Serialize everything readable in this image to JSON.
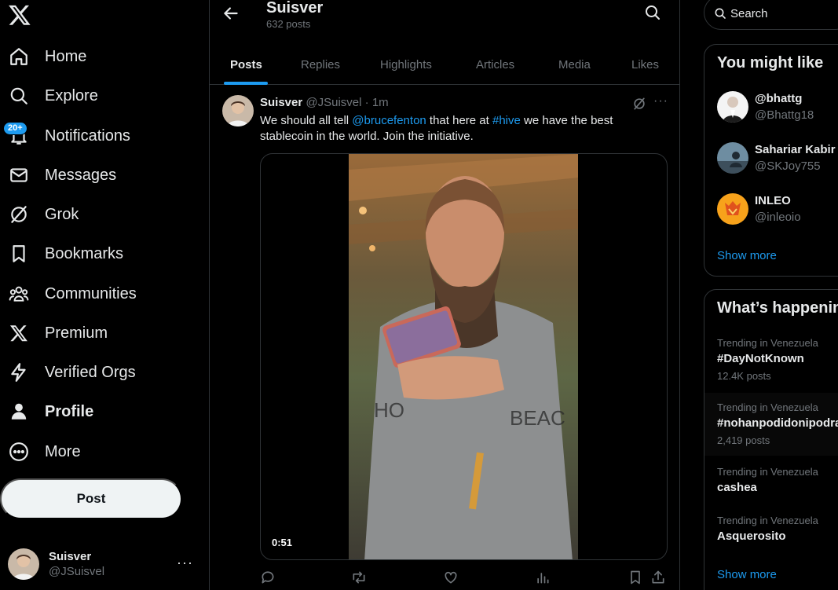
{
  "sidebar": {
    "logo": "x-logo-icon",
    "nav": [
      {
        "label": "Home",
        "icon": "home-icon"
      },
      {
        "label": "Explore",
        "icon": "search-icon"
      },
      {
        "label": "Notifications",
        "icon": "bell-icon",
        "badge": "20+"
      },
      {
        "label": "Messages",
        "icon": "envelope-icon"
      },
      {
        "label": "Grok",
        "icon": "grok-icon"
      },
      {
        "label": "Bookmarks",
        "icon": "bookmark-icon"
      },
      {
        "label": "Communities",
        "icon": "people-icon"
      },
      {
        "label": "Premium",
        "icon": "x-logo-icon"
      },
      {
        "label": "Verified Orgs",
        "icon": "lightning-icon"
      },
      {
        "label": "Profile",
        "icon": "person-icon"
      },
      {
        "label": "More",
        "icon": "more-circle-icon"
      }
    ],
    "post_button": "Post",
    "account": {
      "name": "Suisver",
      "handle": "@JSuisvel",
      "more": "···"
    }
  },
  "header": {
    "title": "Suisver",
    "subtitle": "632 posts"
  },
  "tabs": [
    "Posts",
    "Replies",
    "Highlights",
    "Articles",
    "Media",
    "Likes"
  ],
  "active_tab": "Posts",
  "tweet": {
    "name": "Suisver",
    "handle": "@JSuisvel",
    "separator": "·",
    "time": "1m",
    "text_parts": {
      "p1": "We should all tell ",
      "mention": "@brucefenton",
      "p2": "  that here at ",
      "hashtag": "#hive",
      "p3": " we have the best stablecoin in the world. Join the initiative."
    },
    "video_duration": "0:51",
    "more": "···"
  },
  "right": {
    "search_placeholder": "Search",
    "you_might_like": {
      "title": "You might like",
      "accounts": [
        {
          "name": "@bhattg",
          "handle": "@Bhattg18"
        },
        {
          "name": "Sahariar Kabir",
          "handle": "@SKJoy755"
        },
        {
          "name": "INLEO",
          "handle": "@inleoio"
        }
      ],
      "show_more": "Show more"
    },
    "whats_happening": {
      "title": "What’s happening",
      "trends": [
        {
          "context": "Trending in Venezuela",
          "name": "#DayNotKnown",
          "count": "12.4K posts"
        },
        {
          "context": "Trending in Venezuela",
          "name": "#nohanpodidonipodran",
          "count": "2,419 posts"
        },
        {
          "context": "Trending in Venezuela",
          "name": "cashea",
          "count": ""
        },
        {
          "context": "Trending in Venezuela",
          "name": "Asquerosito",
          "count": ""
        }
      ],
      "show_more": "Show more"
    }
  },
  "colors": {
    "accent": "#1d9bf0",
    "background": "#000000",
    "border": "#2f3336",
    "muted": "#71767b"
  }
}
